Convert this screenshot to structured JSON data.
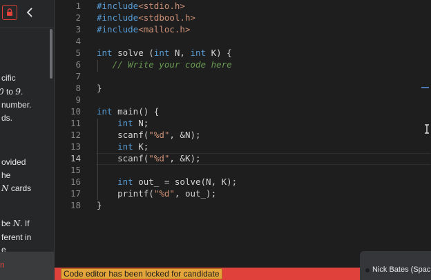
{
  "problem_panel": {
    "lines": [
      {
        "id": "l1",
        "parts": [
          "cific"
        ]
      },
      {
        "id": "l2",
        "parts": [
          "0",
          " to ",
          "9",
          "."
        ]
      },
      {
        "id": "l3",
        "parts": [
          "number."
        ]
      },
      {
        "id": "l4",
        "parts": [
          "ds."
        ]
      },
      {
        "id": "l5",
        "parts": [
          "ovided"
        ]
      },
      {
        "id": "l6",
        "parts": [
          "he"
        ]
      },
      {
        "id": "l7",
        "parts": [
          "N",
          " cards"
        ]
      },
      {
        "id": "l8",
        "parts": [
          " be ",
          "N",
          ". If"
        ]
      },
      {
        "id": "l9",
        "parts": [
          "ferent in"
        ]
      },
      {
        "id": "l10",
        "parts": [
          "e"
        ]
      }
    ],
    "bottom_text": "n"
  },
  "editor": {
    "line_numbers": [
      "1",
      "2",
      "3",
      "4",
      "5",
      "6",
      "7",
      "8",
      "9",
      "10",
      "11",
      "12",
      "13",
      "14",
      "15",
      "16",
      "17",
      "18"
    ],
    "active_line": 14,
    "code": {
      "l1a": "#include",
      "l1b": "<stdio.h>",
      "l2a": "#include",
      "l2b": "<stdbool.h>",
      "l3a": "#include",
      "l3b": "<malloc.h>",
      "l5a": "int",
      "l5b": " solve (",
      "l5c": "int",
      "l5d": " N, ",
      "l5e": "int",
      "l5f": " K) {",
      "l6": "   // Write your code here",
      "l8": "}",
      "l10a": "int",
      "l10b": " main() {",
      "l11a": "    ",
      "l11b": "int",
      "l11c": " N;",
      "l12a": "    scanf(",
      "l12b": "\"%d\"",
      "l12c": ", &N);",
      "l13a": "    ",
      "l13b": "int",
      "l13c": " K;",
      "l14a": "    scanf(",
      "l14b": "\"%d\"",
      "l14c": ", &K);",
      "l16a": "    ",
      "l16b": "int",
      "l16c": " out_ = solve(N, K);",
      "l17a": "    printf(",
      "l17b": "\"%d\"",
      "l17c": ", out_);",
      "l18": "}"
    }
  },
  "status_bar": {
    "message": "Code editor has been locked for candidate"
  },
  "participant": {
    "name": "Nick Bates (Spacio"
  },
  "colors": {
    "accent_red": "#e0413a",
    "lock_message_bg": "#e3a43a",
    "keyword": "#569cd6",
    "string": "#ce9178",
    "comment": "#6a9955"
  },
  "icons": {
    "lock": "lock-icon",
    "back": "chevron-left-icon"
  }
}
